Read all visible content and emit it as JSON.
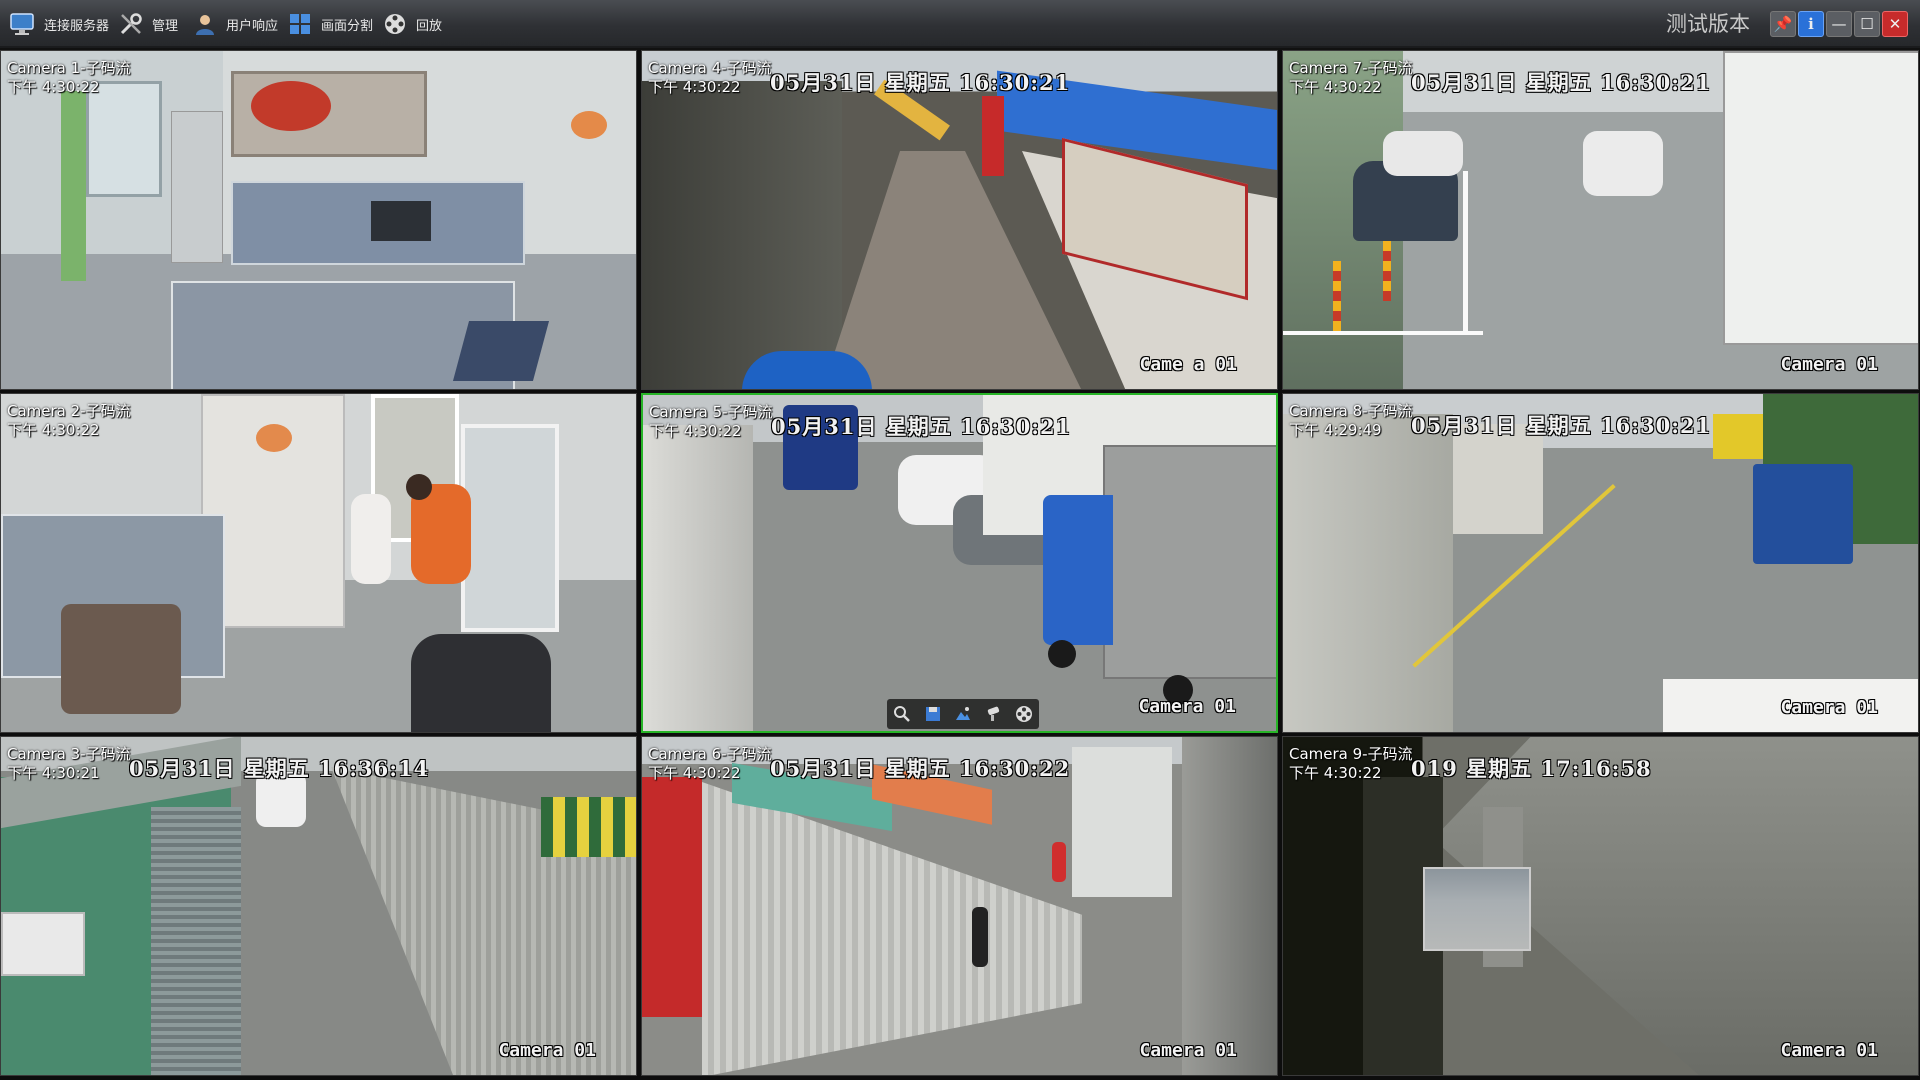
{
  "toolbar": {
    "items": [
      {
        "label": "连接服务器",
        "icon": "monitor-connect-icon"
      },
      {
        "label": "管理",
        "icon": "tools-icon"
      },
      {
        "label": "用户响应",
        "icon": "user-icon"
      },
      {
        "label": "画面分割",
        "icon": "grid-split-icon"
      },
      {
        "label": "回放",
        "icon": "film-reel-icon"
      }
    ],
    "version_label": "测试版本",
    "window_buttons": [
      "pin-icon",
      "info-icon",
      "minimize-icon",
      "maximize-icon",
      "close-icon"
    ]
  },
  "cameras": [
    {
      "name": "Camera 1-子码流",
      "time": "下午 4:30:22",
      "stamp": "",
      "cam_label": "",
      "selected": false
    },
    {
      "name": "Camera 4-子码流",
      "time": "下午 4:30:22",
      "stamp": "05月31日 星期五 16:30:21",
      "cam_label": "Came  a 01",
      "selected": false
    },
    {
      "name": "Camera 7-子码流",
      "time": "下午 4:30:22",
      "stamp": "05月31日 星期五 16:30:21",
      "cam_label": "Camera 01",
      "selected": false
    },
    {
      "name": "Camera 2-子码流",
      "time": "下午 4:30:22",
      "stamp": "",
      "cam_label": "",
      "selected": false
    },
    {
      "name": "Camera 5-子码流",
      "time": "下午 4:30:22",
      "stamp": "05月31日 星期五 16:30:21",
      "cam_label": "Camera 01",
      "selected": true
    },
    {
      "name": "Camera 8-子码流",
      "time": "下午 4:29:49",
      "stamp": "05月31日 星期五 16:30:21",
      "cam_label": "Camera 01",
      "selected": false
    },
    {
      "name": "Camera 3-子码流",
      "time": "下午 4:30:21",
      "stamp": "05月31日 星期五 16:36:14",
      "cam_label": "Camera 01",
      "selected": false
    },
    {
      "name": "Camera 6-子码流",
      "time": "下午 4:30:22",
      "stamp": "05月31日 星期五 16:30:22",
      "cam_label": "Camera 01",
      "selected": false
    },
    {
      "name": "Camera 9-子码流",
      "time": "下午 4:30:22",
      "stamp": "019 星期五 17:16:58",
      "cam_label": "Camera 01",
      "selected": false
    }
  ],
  "playback_controls": [
    "zoom-icon",
    "save-icon",
    "snapshot-icon",
    "ptz-icon",
    "film-reel-icon"
  ]
}
